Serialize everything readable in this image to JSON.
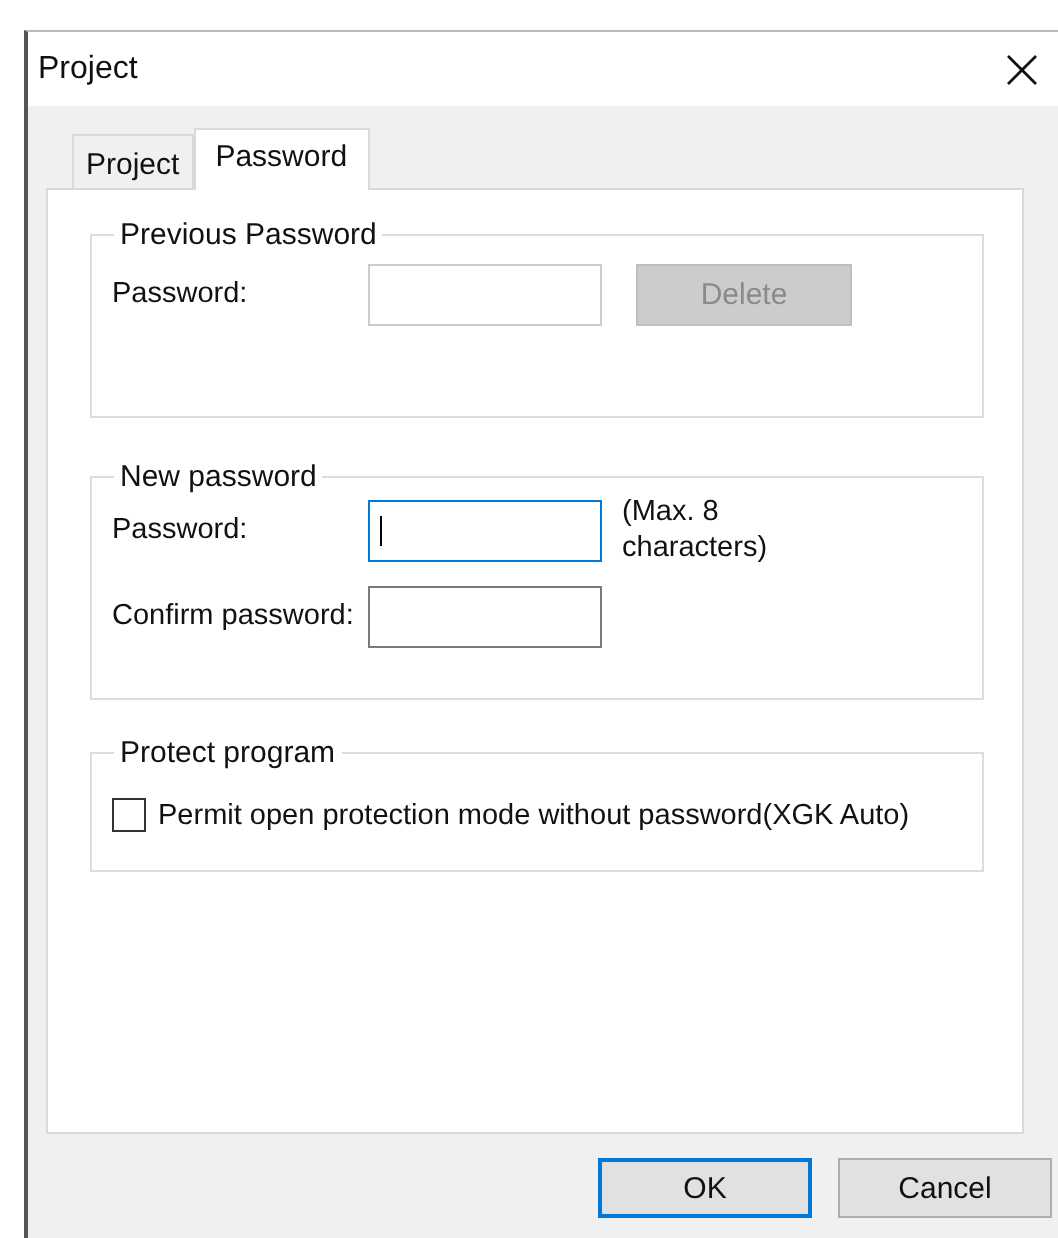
{
  "window": {
    "title": "Project"
  },
  "tabs": [
    {
      "label": "Project",
      "selected": false
    },
    {
      "label": "Password",
      "selected": true
    }
  ],
  "previous_password": {
    "title": "Previous Password",
    "label": "Password:",
    "field": {
      "focused": false
    },
    "button": {
      "label": "Delete",
      "disabled": true
    }
  },
  "new_password": {
    "title": "New password",
    "password_label": "Password:",
    "password_field": {
      "focused": true
    },
    "hint": "(Max. 8 characters)",
    "confirm_label": "Confirm password:",
    "confirm_field": {
      "focused": false
    }
  },
  "protect_program": {
    "title": "Protect program",
    "checkbox": {
      "label": "Permit open protection mode without password(XGK Auto)",
      "checked": false
    }
  },
  "buttons": [
    {
      "label": "OK",
      "default": true
    },
    {
      "label": "Cancel",
      "default": false
    }
  ]
}
